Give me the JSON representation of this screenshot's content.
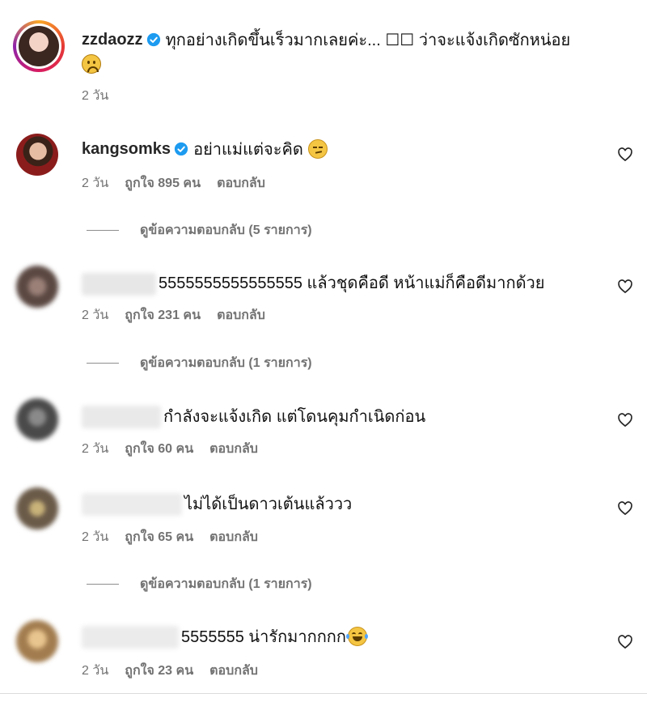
{
  "post": {
    "username": "zzdaozz",
    "caption_line1": "ทุกอย่างเกิดขึ้นเร็วมากเลยค่ะ... ☐☐ ว่าจะแจ้งเกิดซักหน่อย",
    "emoji": "🙁",
    "time": "2 วัน"
  },
  "comments": [
    {
      "username": "kangsomks",
      "text": "อย่าแม่แต่จะคิด",
      "emoji": "😏",
      "time": "2 วัน",
      "likes": "ถูกใจ 895 คน",
      "reply": "ตอบกลับ",
      "view_replies": "ดูข้อความตอบกลับ (5 รายการ)"
    },
    {
      "username": "",
      "text": "5555555555555555 แล้วชุดคือดี หน้าแม่ก็คือดีมากด้วย",
      "time": "2 วัน",
      "likes": "ถูกใจ 231 คน",
      "reply": "ตอบกลับ",
      "view_replies": "ดูข้อความตอบกลับ (1 รายการ)"
    },
    {
      "username": "",
      "text": "กำลังจะแจ้งเกิด แต่โดนคุมกำเนิดก่อน",
      "time": "2 วัน",
      "likes": "ถูกใจ 60 คน",
      "reply": "ตอบกลับ"
    },
    {
      "username": "",
      "text": "ไม่ได้เป็นดาวเต้นแล้ววว",
      "time": "2 วัน",
      "likes": "ถูกใจ 65 คน",
      "reply": "ตอบกลับ",
      "view_replies": "ดูข้อความตอบกลับ (1 รายการ)"
    },
    {
      "username": "",
      "text": "5555555 น่ารักมากกกก",
      "emoji": "😂",
      "time": "2 วัน",
      "likes": "ถูกใจ 23 คน",
      "reply": "ตอบกลับ"
    }
  ],
  "icons": {
    "verified": "verified-badge-icon",
    "heart": "heart-outline-icon"
  },
  "colors": {
    "verified": "#1d9bf0",
    "meta": "#737373",
    "story_ring_start": "#f9a825",
    "story_ring_end": "#d81b60"
  }
}
